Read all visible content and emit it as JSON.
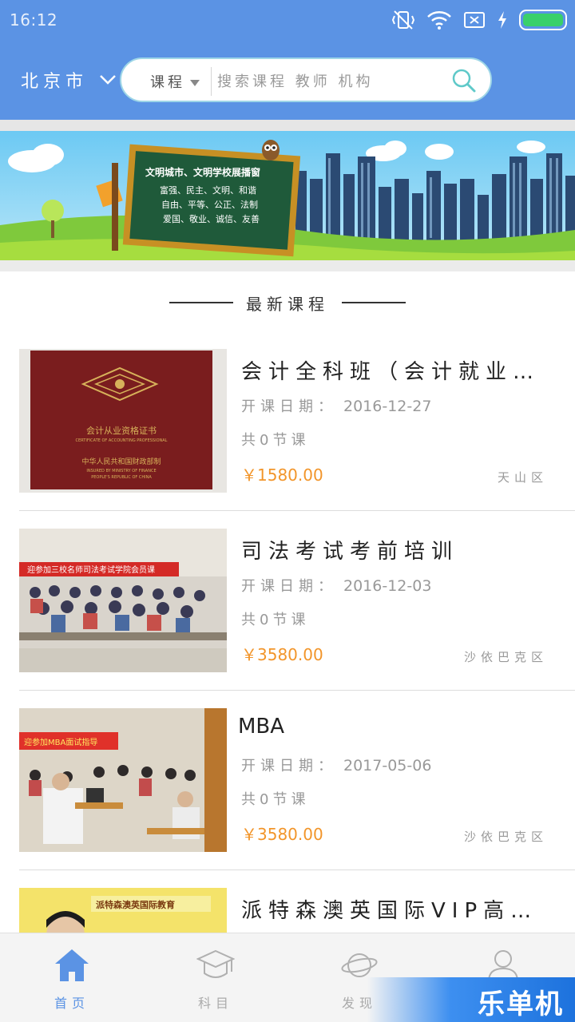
{
  "status_bar": {
    "time": "16:12",
    "icons": [
      "vibrate-off-icon",
      "wifi-icon",
      "sim-off-icon",
      "charging-icon",
      "battery-icon"
    ],
    "battery_level": 1.0
  },
  "header": {
    "city": "北京市",
    "search": {
      "category": "课程",
      "placeholder": "搜索课程 教师 机构"
    }
  },
  "banner": {
    "board_title": "文明城市、文明学校展播窗",
    "board_lines": [
      "富强、民主、文明、和谐",
      "自由、平等、公正、法制",
      "爱国、敬业、诚信、友善"
    ]
  },
  "section": {
    "title": "最新课程"
  },
  "courses": [
    {
      "title": "会计全科班（会计就业…",
      "date_label": "开课日期：",
      "date": "2016-12-27",
      "lessons": "共0节课",
      "price": "￥1580.00",
      "district": "天山区",
      "thumb_text": [
        "会计从业资格证书",
        "CERTIFICATE OF ACCOUNTING PROFESSIONAL",
        "中华人民共和国财政部制",
        "INSURED BY MINISTRY OF FINANCE",
        "PEOPLE'S REPUBLIC OF CHINA"
      ]
    },
    {
      "title": "司法考试考前培训",
      "date_label": "开课日期：",
      "date": "2016-12-03",
      "lessons": "共0节课",
      "price": "￥3580.00",
      "district": "沙依巴克区",
      "thumb_text": [
        "迎参加三校名师司法考试学院会员课"
      ]
    },
    {
      "title": "MBA",
      "date_label": "开课日期：",
      "date": "2017-05-06",
      "lessons": "共0节课",
      "price": "￥3580.00",
      "district": "沙依巴克区",
      "thumb_text": [
        "迎参加MBA面试指导"
      ]
    },
    {
      "title": "派特森澳英国际VIP高…",
      "thumb_text": [
        "派特森澳英国际教育"
      ]
    }
  ],
  "bottom_nav": [
    {
      "label": "首页",
      "icon": "home-icon",
      "active": true
    },
    {
      "label": "科目",
      "icon": "graduation-cap-icon",
      "active": false
    },
    {
      "label": "发现",
      "icon": "planet-icon",
      "active": false
    },
    {
      "label": "我的",
      "icon": "user-icon",
      "active": false
    }
  ],
  "watermark": "乐单机",
  "colors": {
    "header_bg": "#5b93e4",
    "price": "#f2952a",
    "active_nav": "#5b93e4"
  }
}
